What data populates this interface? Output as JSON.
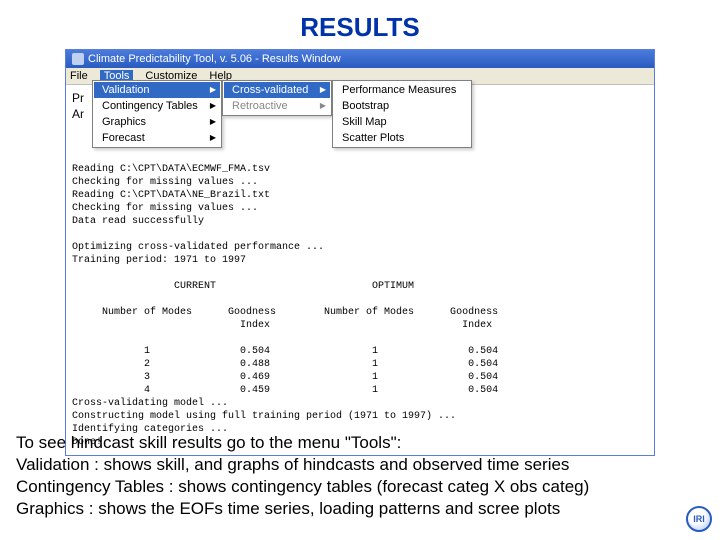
{
  "slide": {
    "title": "RESULTS"
  },
  "window": {
    "title": "Climate Predictability Tool, v. 5.06 - Results Window",
    "menubar": [
      "File",
      "Tools",
      "Customize",
      "Help"
    ],
    "behind": {
      "l1": "Pr",
      "l2": "Ar"
    }
  },
  "menu_tools": {
    "items": [
      {
        "label": "Validation",
        "hi": true,
        "arrow": true
      },
      {
        "label": "Contingency Tables",
        "arrow": true
      },
      {
        "label": "Graphics",
        "arrow": true
      },
      {
        "label": "Forecast",
        "arrow": true
      }
    ]
  },
  "menu_validation": {
    "items": [
      {
        "label": "Cross-validated",
        "hi": true,
        "arrow": true
      },
      {
        "label": "Retroactive",
        "dim": true,
        "arrow": true
      }
    ]
  },
  "menu_cv": {
    "items": [
      {
        "label": "Performance Measures"
      },
      {
        "label": "Bootstrap"
      },
      {
        "label": "Skill Map"
      },
      {
        "label": "Scatter Plots"
      }
    ]
  },
  "console": {
    "lines": [
      "Reading C:\\CPT\\DATA\\ECMWF_FMA.tsv",
      "Checking for missing values ...",
      "Reading C:\\CPT\\DATA\\NE_Brazil.txt",
      "Checking for missing values ...",
      "Data read successfully",
      "",
      "Optimizing cross-validated performance ...",
      "Training period: 1971 to 1997",
      "",
      "                 CURRENT                          OPTIMUM",
      "",
      "     Number of Modes      Goodness        Number of Modes      Goodness",
      "                            Index                                Index",
      "",
      "            1               0.504                 1               0.504",
      "            2               0.488                 1               0.504",
      "            3               0.469                 1               0.504",
      "            4               0.459                 1               0.504",
      "Cross-validating model ...",
      "Constructing model using full training period (1971 to 1997) ...",
      "Identifying categories ...",
      "Done!"
    ]
  },
  "caption": {
    "l1a": "To see hindcast skill results go to the menu ",
    "l1b": "\"Tools\"",
    "l1c": ":",
    "l2": "Validation : shows skill, and graphs of hindcasts and observed time series",
    "l3": "Contingency Tables : shows contingency tables (forecast categ X obs categ)",
    "l4": "Graphics : shows the EOFs time series, loading patterns and scree plots"
  },
  "logo": {
    "text": "IRI"
  },
  "chart_data": {
    "type": "table",
    "title": "Optimizing cross-validated performance",
    "training_period": [
      1971,
      1997
    ],
    "columns": [
      "Number of Modes (Current)",
      "Goodness Index (Current)",
      "Number of Modes (Optimum)",
      "Goodness Index (Optimum)"
    ],
    "rows": [
      [
        1,
        0.504,
        1,
        0.504
      ],
      [
        2,
        0.488,
        1,
        0.504
      ],
      [
        3,
        0.469,
        1,
        0.504
      ],
      [
        4,
        0.459,
        1,
        0.504
      ]
    ]
  }
}
